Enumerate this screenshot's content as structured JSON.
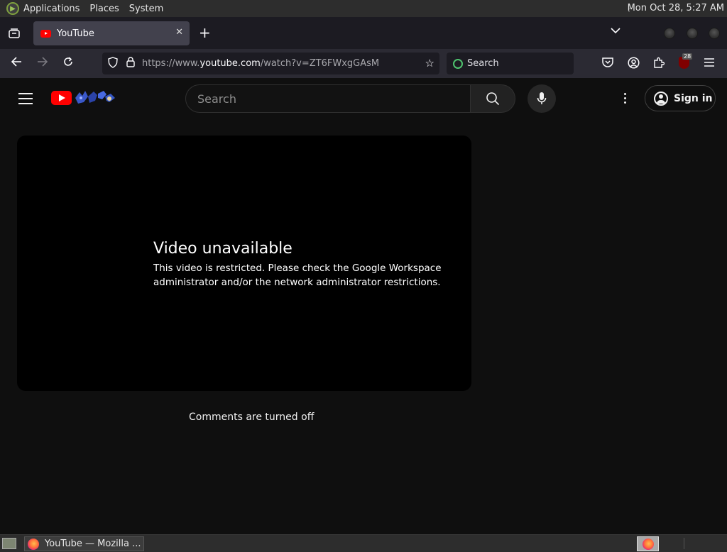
{
  "top_panel": {
    "menus": [
      "Applications",
      "Places",
      "System"
    ],
    "clock": "Mon Oct 28,  5:27 AM"
  },
  "browser": {
    "tab": {
      "title": "YouTube",
      "close_glyph": "✕"
    },
    "new_tab_glyph": "+",
    "tab_list_glyph": "⌄",
    "url_prefix": "https://www.",
    "url_host": "youtube.com",
    "url_path": "/watch?v=ZT6FWxgGAsM",
    "search_placeholder": "Search",
    "ublock_badge": "28"
  },
  "youtube": {
    "search_placeholder": "Search",
    "signin_label": "Sign in",
    "error_title": "Video unavailable",
    "error_message": "This video is restricted. Please check the Google Workspace administrator and/or the network administrator restrictions.",
    "comments_status": "Comments are turned off"
  },
  "taskbar": {
    "window_title": "YouTube — Mozilla ..."
  },
  "colors": {
    "youtube_red": "#ff0000",
    "page_bg": "#0f0f0f",
    "browser_chrome": "#2b2a33"
  }
}
